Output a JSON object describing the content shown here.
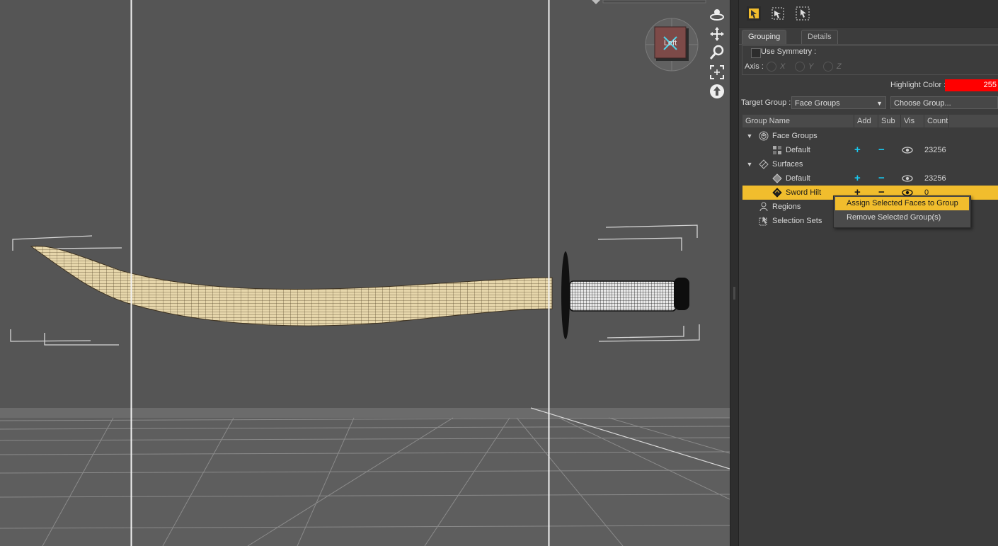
{
  "viewport": {
    "view_cube_label": "Left",
    "nav_tools": [
      "orbit-icon",
      "pan-icon",
      "zoom-icon",
      "frame-icon",
      "reset-view-icon"
    ]
  },
  "toolbar": {
    "tools": [
      "node-selection-icon",
      "geometry-editor-icon",
      "region-select-icon"
    ],
    "accent_color": "#f1bd2d"
  },
  "tabs": [
    {
      "label": "Grouping",
      "active": true
    },
    {
      "label": "Details",
      "active": false
    }
  ],
  "symmetry": {
    "use_label": "Use Symmetry :",
    "axis_label": "Axis :",
    "axes": [
      "X",
      "Y",
      "Z"
    ]
  },
  "highlight": {
    "label": "Highlight Color :",
    "value": "255",
    "color": "#ff0000"
  },
  "target_group": {
    "label": "Target Group :",
    "value": "Face Groups",
    "choose_label": "Choose Group..."
  },
  "columns": [
    "Group Name",
    "Add",
    "Sub",
    "Vis",
    "Count"
  ],
  "tree": [
    {
      "label": "Face Groups",
      "icon": "face-groups-icon",
      "expanded": true
    },
    {
      "label": "Default",
      "icon": "face-group-icon",
      "add": "+",
      "sub": "−",
      "count": "23256"
    },
    {
      "label": "Surfaces",
      "icon": "surfaces-icon",
      "expanded": true
    },
    {
      "label": "Default",
      "icon": "surface-icon",
      "add": "+",
      "sub": "−",
      "count": "23256"
    },
    {
      "label": "Sword Hilt",
      "icon": "surface-icon",
      "add": "+",
      "sub": "−",
      "count": "0",
      "selected": true
    },
    {
      "label": "Regions",
      "icon": "regions-icon"
    },
    {
      "label": "Selection Sets",
      "icon": "selection-sets-icon"
    }
  ],
  "context_menu": {
    "items": [
      {
        "label": "Assign Selected Faces to Group",
        "hover": true
      },
      {
        "label": "Remove Selected Group(s)",
        "hover": false
      }
    ]
  }
}
